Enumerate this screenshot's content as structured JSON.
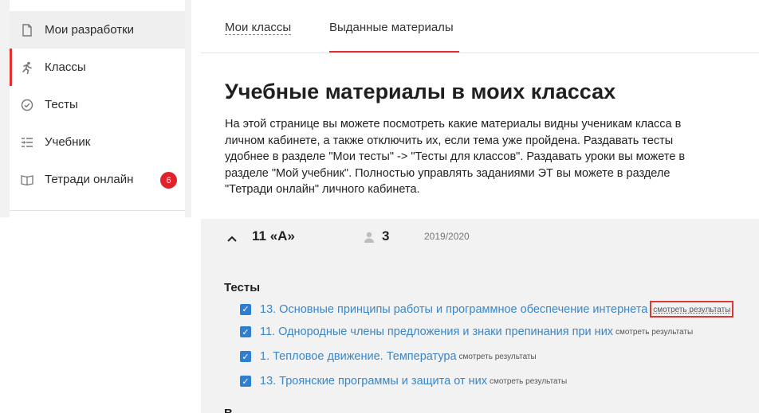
{
  "sidebar": {
    "items": [
      {
        "label": "Мои разработки",
        "icon": "document-icon"
      },
      {
        "label": "Классы",
        "icon": "runner-icon"
      },
      {
        "label": "Тесты",
        "icon": "check-circle-icon"
      },
      {
        "label": "Учебник",
        "icon": "list-icon"
      },
      {
        "label": "Тетради онлайн",
        "icon": "book-icon",
        "badge": "6"
      }
    ]
  },
  "tabs": {
    "items": [
      {
        "label": "Мои классы"
      },
      {
        "label": "Выданные материалы"
      }
    ]
  },
  "page": {
    "title": "Учебные материалы в моих классах",
    "description": "На этой странице вы можете посмотреть какие материалы видны ученикам класса в личном кабинете, а также отключить их, если тема уже пройдена. Раздавать тесты удобнее в разделе \"Мои тесты\" -> \"Тесты для классов\". Раздавать уроки вы можете в разделе \"Мой учебник\". Полностью управлять заданиями ЭТ вы можете в разделе \"Тетради онлайн\" личного кабинета."
  },
  "class": {
    "name": "11 «А»",
    "students_count": "3",
    "year": "2019/2020",
    "tests_section_title": "Тесты",
    "tests": [
      {
        "title": "13. Основные принципы работы и программное обеспечение интернета",
        "link": "смотреть результаты"
      },
      {
        "title": "11. Однородные члены предложения и знаки препинания при них",
        "link": "смотреть результаты"
      },
      {
        "title": "1. Тепловое движение. Температура",
        "link": "смотреть результаты"
      },
      {
        "title": "13. Троянские программы и защита от них",
        "link": "смотреть результаты"
      }
    ],
    "next_section_title": "В"
  },
  "colors": {
    "accent_red": "#e0312f",
    "link_blue": "#3a86c8",
    "checkbox_blue": "#2f7fd1",
    "badge_red": "#e0222a"
  }
}
